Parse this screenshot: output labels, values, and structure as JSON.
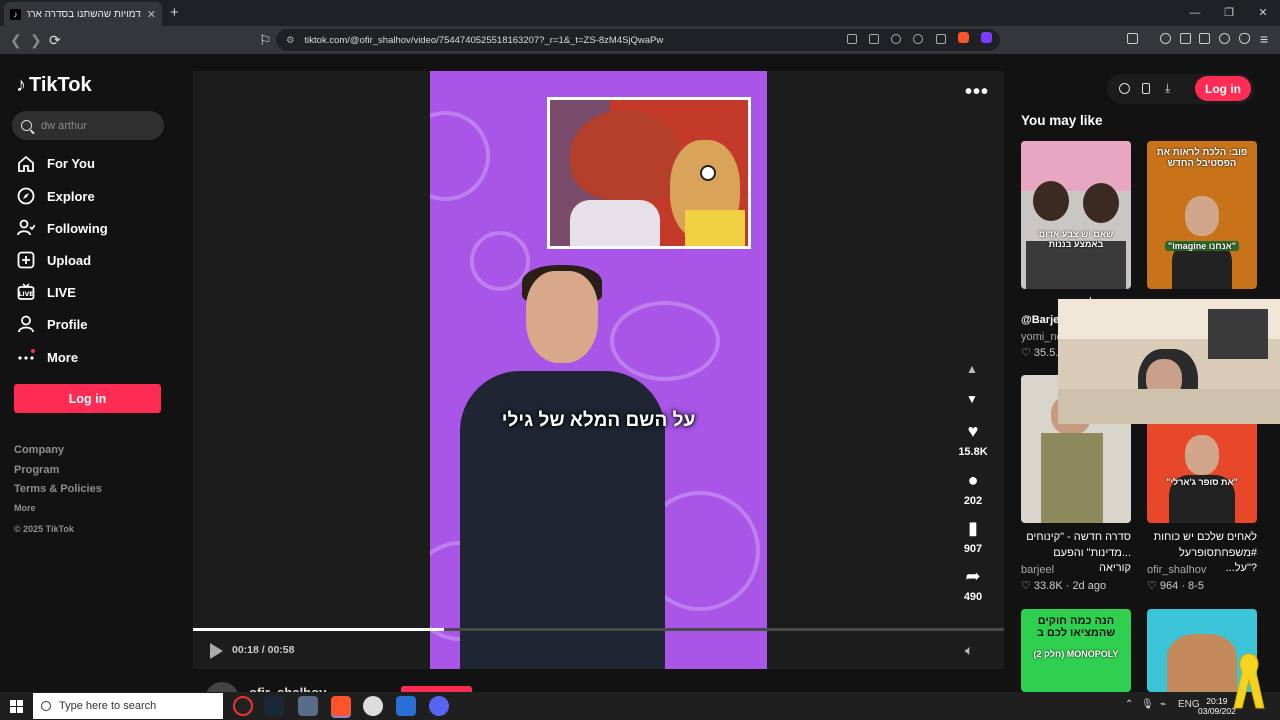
{
  "browser": {
    "tab_title": "דמויות שהשתנו בסדרה ארתור | ♫",
    "tab_close": "✕",
    "new_tab": "+",
    "window_controls": [
      "—",
      "❐",
      "✕"
    ],
    "url": "tiktok.com/@ofir_shalhov/video/7544740525518163207?_r=1&_t=ZS-8zM4SjQwaPw"
  },
  "sidebar": {
    "logo_text": "TikTok",
    "search_placeholder": "dw arthur",
    "nav": [
      {
        "label": "For You",
        "icon": "home-icon"
      },
      {
        "label": "Explore",
        "icon": "compass-icon"
      },
      {
        "label": "Following",
        "icon": "following-icon"
      },
      {
        "label": "Upload",
        "icon": "upload-icon"
      },
      {
        "label": "LIVE",
        "icon": "live-icon"
      },
      {
        "label": "Profile",
        "icon": "profile-icon"
      },
      {
        "label": "More",
        "icon": "more-icon"
      }
    ],
    "login_label": "Log in",
    "footer_links": [
      "Company",
      "Program",
      "Terms & Policies"
    ],
    "footer_more": "More",
    "copyright": "© 2025 TikTok"
  },
  "video": {
    "caption": "על השם המלא של גילי",
    "time": "00:18 / 00:58",
    "progress_fraction": 0.31,
    "author_name": "ofir_shalhov",
    "actions": [
      {
        "name": "like",
        "icon": "♥",
        "count": "15.8K"
      },
      {
        "name": "comment",
        "icon": "●",
        "count": "202"
      },
      {
        "name": "save",
        "icon": "▮",
        "count": "907"
      },
      {
        "name": "share",
        "icon": "➦",
        "count": "490"
      }
    ]
  },
  "right": {
    "login_label": "Log in",
    "section_title": "You may like",
    "cards": [
      {
        "overlay_top": "",
        "overlay_bottom": "שאם יש צבע אדום באמצע בננות",
        "title": "...ורה שלנו",
        "title2": "@Barje...",
        "author": "yomi_ne...",
        "likes": "35.5..."
      },
      {
        "overlay_top": "פוב: הלכת לראות את הפסטיבל החדש",
        "overlay_bottom": "\"אנחנו imagine\"",
        "title": "",
        "title2": "",
        "author": "",
        "likes": ""
      },
      {
        "overlay_top": "",
        "overlay_bottom": "",
        "title": "סדרה חדשה - \"קינוחים",
        "title2": "...מדינות\" והפעם קוריאה",
        "author": "barjeel",
        "likes": "33.8K · 2d ago"
      },
      {
        "overlay_top": "",
        "overlay_bottom": "\"את סופר ג'ארלי\"",
        "title": "לאחים שלכם יש כוחות",
        "title2": "#משפחתסופרעל ?\"על...",
        "author": "ofir_shalhov",
        "likes": "964 · 8-5"
      },
      {
        "overlay_top": "הנה כמה חוקים שהמציאו לכם ב",
        "overlay_bottom": "MONOPOLY (חלק 2)",
        "title": "",
        "title2": "",
        "author": "",
        "likes": ""
      },
      {
        "overlay_top": "",
        "overlay_bottom": "",
        "title": "",
        "title2": "",
        "author": "",
        "likes": ""
      }
    ]
  },
  "taskbar": {
    "search_placeholder": "Type here to search",
    "lang": "ENG",
    "time": "20:19",
    "date": "03/09/202"
  },
  "colors": {
    "accent": "#fe2c55",
    "video_bg": "#a855e8"
  }
}
